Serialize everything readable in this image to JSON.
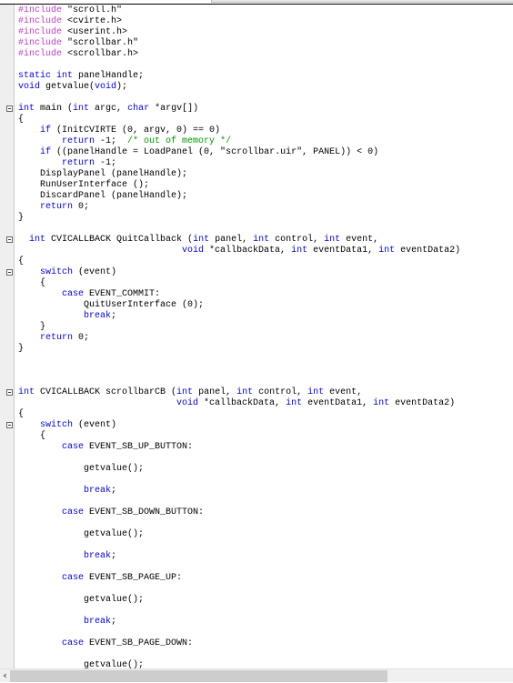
{
  "code": {
    "lines": [
      {
        "fold": false,
        "tokens": [
          [
            "#include",
            "p"
          ],
          [
            " \"scroll.h\"",
            "t"
          ]
        ]
      },
      {
        "fold": false,
        "tokens": [
          [
            "#include",
            "p"
          ],
          [
            " <cvirte.h>",
            "t"
          ]
        ]
      },
      {
        "fold": false,
        "tokens": [
          [
            "#include",
            "p"
          ],
          [
            " <userint.h>",
            "t"
          ]
        ]
      },
      {
        "fold": false,
        "tokens": [
          [
            "#include",
            "p"
          ],
          [
            " \"scrollbar.h\"",
            "t"
          ]
        ]
      },
      {
        "fold": false,
        "tokens": [
          [
            "#include",
            "p"
          ],
          [
            " <scrollbar.h>",
            "t"
          ]
        ]
      },
      {
        "fold": false,
        "tokens": []
      },
      {
        "fold": false,
        "tokens": [
          [
            "static",
            "k"
          ],
          [
            " ",
            "t"
          ],
          [
            "int",
            "k"
          ],
          [
            " panelHandle;",
            "t"
          ]
        ]
      },
      {
        "fold": false,
        "tokens": [
          [
            "void",
            "k"
          ],
          [
            " getvalue(",
            "t"
          ],
          [
            "void",
            "k"
          ],
          [
            ");",
            "t"
          ]
        ]
      },
      {
        "fold": false,
        "tokens": []
      },
      {
        "fold": true,
        "tokens": [
          [
            "int",
            "k"
          ],
          [
            " main (",
            "t"
          ],
          [
            "int",
            "k"
          ],
          [
            " argc, ",
            "t"
          ],
          [
            "char",
            "k"
          ],
          [
            " *argv[])",
            "t"
          ]
        ]
      },
      {
        "fold": false,
        "tokens": [
          [
            "{",
            "t"
          ]
        ]
      },
      {
        "fold": false,
        "tokens": [
          [
            "    ",
            "t"
          ],
          [
            "if",
            "k"
          ],
          [
            " (InitCVIRTE (0, argv, 0) == 0)",
            "t"
          ]
        ]
      },
      {
        "fold": false,
        "tokens": [
          [
            "        ",
            "t"
          ],
          [
            "return",
            "k"
          ],
          [
            " -1;  ",
            "t"
          ],
          [
            "/* out of memory */",
            "c"
          ]
        ]
      },
      {
        "fold": false,
        "tokens": [
          [
            "    ",
            "t"
          ],
          [
            "if",
            "k"
          ],
          [
            " ((panelHandle = LoadPanel (0, \"scrollbar.uir\", PANEL)) < 0)",
            "t"
          ]
        ]
      },
      {
        "fold": false,
        "tokens": [
          [
            "        ",
            "t"
          ],
          [
            "return",
            "k"
          ],
          [
            " -1;",
            "t"
          ]
        ]
      },
      {
        "fold": false,
        "tokens": [
          [
            "    DisplayPanel (panelHandle);",
            "t"
          ]
        ]
      },
      {
        "fold": false,
        "tokens": [
          [
            "    RunUserInterface ();",
            "t"
          ]
        ]
      },
      {
        "fold": false,
        "tokens": [
          [
            "    DiscardPanel (panelHandle);",
            "t"
          ]
        ]
      },
      {
        "fold": false,
        "tokens": [
          [
            "    ",
            "t"
          ],
          [
            "return",
            "k"
          ],
          [
            " 0;",
            "t"
          ]
        ]
      },
      {
        "fold": false,
        "tokens": [
          [
            "}",
            "t"
          ]
        ]
      },
      {
        "fold": false,
        "tokens": []
      },
      {
        "fold": true,
        "tokens": [
          [
            "  ",
            "t"
          ],
          [
            "int",
            "k"
          ],
          [
            " CVICALLBACK QuitCallback (",
            "t"
          ],
          [
            "int",
            "k"
          ],
          [
            " panel, ",
            "t"
          ],
          [
            "int",
            "k"
          ],
          [
            " control, ",
            "t"
          ],
          [
            "int",
            "k"
          ],
          [
            " event,",
            "t"
          ]
        ]
      },
      {
        "fold": false,
        "tokens": [
          [
            "                              ",
            "t"
          ],
          [
            "void",
            "k"
          ],
          [
            " *callbackData, ",
            "t"
          ],
          [
            "int",
            "k"
          ],
          [
            " eventData1, ",
            "t"
          ],
          [
            "int",
            "k"
          ],
          [
            " eventData2)",
            "t"
          ]
        ]
      },
      {
        "fold": false,
        "tokens": [
          [
            "{",
            "t"
          ]
        ]
      },
      {
        "fold": true,
        "tokens": [
          [
            "    ",
            "t"
          ],
          [
            "switch",
            "k"
          ],
          [
            " (event)",
            "t"
          ]
        ]
      },
      {
        "fold": false,
        "tokens": [
          [
            "    {",
            "t"
          ]
        ]
      },
      {
        "fold": false,
        "tokens": [
          [
            "        ",
            "t"
          ],
          [
            "case",
            "k"
          ],
          [
            " EVENT_COMMIT:",
            "t"
          ]
        ]
      },
      {
        "fold": false,
        "tokens": [
          [
            "            QuitUserInterface (0);",
            "t"
          ]
        ]
      },
      {
        "fold": false,
        "tokens": [
          [
            "            ",
            "t"
          ],
          [
            "break",
            "k"
          ],
          [
            ";",
            "t"
          ]
        ]
      },
      {
        "fold": false,
        "tokens": [
          [
            "    }",
            "t"
          ]
        ]
      },
      {
        "fold": false,
        "tokens": [
          [
            "    ",
            "t"
          ],
          [
            "return",
            "k"
          ],
          [
            " 0;",
            "t"
          ]
        ]
      },
      {
        "fold": false,
        "tokens": [
          [
            "}",
            "t"
          ]
        ]
      },
      {
        "fold": false,
        "tokens": []
      },
      {
        "fold": false,
        "tokens": []
      },
      {
        "fold": false,
        "tokens": []
      },
      {
        "fold": true,
        "tokens": [
          [
            "int",
            "k"
          ],
          [
            " CVICALLBACK scrollbarCB (",
            "t"
          ],
          [
            "int",
            "k"
          ],
          [
            " panel, ",
            "t"
          ],
          [
            "int",
            "k"
          ],
          [
            " control, ",
            "t"
          ],
          [
            "int",
            "k"
          ],
          [
            " event,",
            "t"
          ]
        ]
      },
      {
        "fold": false,
        "tokens": [
          [
            "                             ",
            "t"
          ],
          [
            "void",
            "k"
          ],
          [
            " *callbackData, ",
            "t"
          ],
          [
            "int",
            "k"
          ],
          [
            " eventData1, ",
            "t"
          ],
          [
            "int",
            "k"
          ],
          [
            " eventData2)",
            "t"
          ]
        ]
      },
      {
        "fold": false,
        "tokens": [
          [
            "{",
            "t"
          ]
        ]
      },
      {
        "fold": true,
        "tokens": [
          [
            "    ",
            "t"
          ],
          [
            "switch",
            "k"
          ],
          [
            " (event)",
            "t"
          ]
        ]
      },
      {
        "fold": false,
        "tokens": [
          [
            "    {",
            "t"
          ]
        ]
      },
      {
        "fold": false,
        "tokens": [
          [
            "        ",
            "t"
          ],
          [
            "case",
            "k"
          ],
          [
            " EVENT_SB_UP_BUTTON:",
            "t"
          ]
        ]
      },
      {
        "fold": false,
        "tokens": []
      },
      {
        "fold": false,
        "tokens": [
          [
            "            getvalue();",
            "t"
          ]
        ]
      },
      {
        "fold": false,
        "tokens": []
      },
      {
        "fold": false,
        "tokens": [
          [
            "            ",
            "t"
          ],
          [
            "break",
            "k"
          ],
          [
            ";",
            "t"
          ]
        ]
      },
      {
        "fold": false,
        "tokens": []
      },
      {
        "fold": false,
        "tokens": [
          [
            "        ",
            "t"
          ],
          [
            "case",
            "k"
          ],
          [
            " EVENT_SB_DOWN_BUTTON:",
            "t"
          ]
        ]
      },
      {
        "fold": false,
        "tokens": []
      },
      {
        "fold": false,
        "tokens": [
          [
            "            getvalue();",
            "t"
          ]
        ]
      },
      {
        "fold": false,
        "tokens": []
      },
      {
        "fold": false,
        "tokens": [
          [
            "            ",
            "t"
          ],
          [
            "break",
            "k"
          ],
          [
            ";",
            "t"
          ]
        ]
      },
      {
        "fold": false,
        "tokens": []
      },
      {
        "fold": false,
        "tokens": [
          [
            "        ",
            "t"
          ],
          [
            "case",
            "k"
          ],
          [
            " EVENT_SB_PAGE_UP:",
            "t"
          ]
        ]
      },
      {
        "fold": false,
        "tokens": []
      },
      {
        "fold": false,
        "tokens": [
          [
            "            getvalue();",
            "t"
          ]
        ]
      },
      {
        "fold": false,
        "tokens": []
      },
      {
        "fold": false,
        "tokens": [
          [
            "            ",
            "t"
          ],
          [
            "break",
            "k"
          ],
          [
            ";",
            "t"
          ]
        ]
      },
      {
        "fold": false,
        "tokens": []
      },
      {
        "fold": false,
        "tokens": [
          [
            "        ",
            "t"
          ],
          [
            "case",
            "k"
          ],
          [
            " EVENT_SB_PAGE_DOWN:",
            "t"
          ]
        ]
      },
      {
        "fold": false,
        "tokens": []
      },
      {
        "fold": false,
        "tokens": [
          [
            "            getvalue();",
            "t"
          ]
        ]
      }
    ]
  },
  "colors": {
    "keyword": "#0000ee",
    "preprocessor": "#c040c0",
    "comment": "#009900",
    "text": "#000000"
  },
  "scrollbar": {
    "left_arrow_icon": "chevron-left-icon",
    "arrow_glyph": "‹",
    "thumb_fraction": 0.75
  }
}
